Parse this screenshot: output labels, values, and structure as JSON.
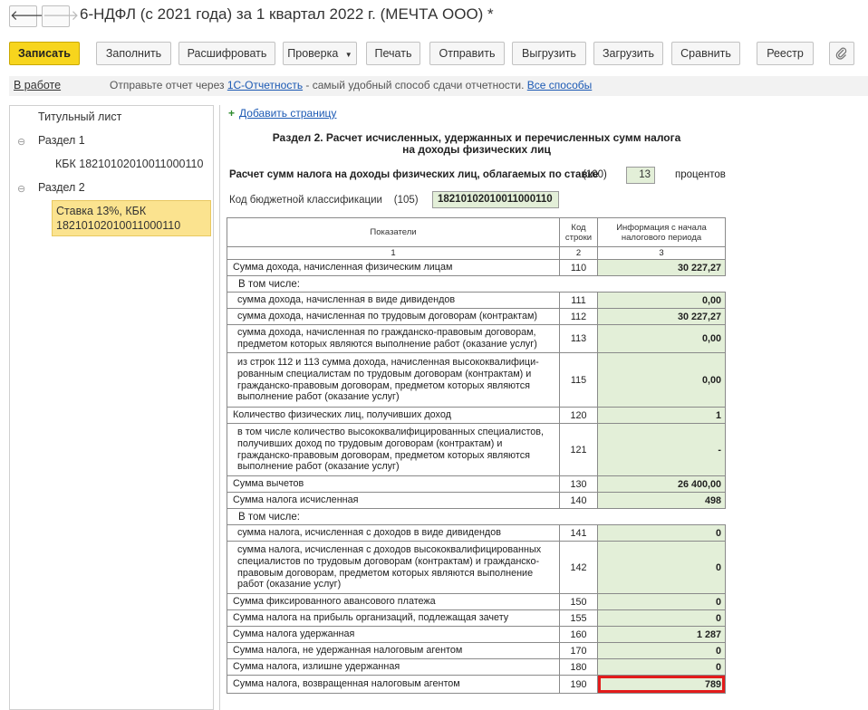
{
  "window": {
    "title": "6-НДФЛ (с 2021 года) за 1 квартал 2022 г. (МЕЧТА ООО) *",
    "back_glyph": "🡐",
    "forward_glyph": "🡒"
  },
  "toolbar": {
    "save": "Записать",
    "fill": "Заполнить",
    "decode": "Расшифровать",
    "check": "Проверка",
    "print": "Печать",
    "send": "Отправить",
    "export": "Выгрузить",
    "import": "Загрузить",
    "compare": "Сравнить",
    "registry": "Реестр",
    "attach_icon": "paperclip-icon"
  },
  "infobar": {
    "status": "В работе",
    "text_before": "Отправьте отчет через ",
    "link1": "1С-Отчетность",
    "text_after": " - самый удобный способ сдачи отчетности. ",
    "link2": "Все способы"
  },
  "tree": {
    "title_page": "Титульный лист",
    "section1": "Раздел 1",
    "section1_child": "КБК 18210102010011000110",
    "section2": "Раздел 2",
    "section2_child_line1": "Ставка 13%, КБК",
    "section2_child_line2": "18210102010011000110"
  },
  "form": {
    "add_page": "Добавить страницу",
    "section_title_line1": "Раздел 2. Расчет исчисленных, удержанных и перечисленных сумм налога",
    "section_title_line2": "на доходы физических лиц",
    "rate_label": "Расчет сумм налога на доходы физических лиц, облагаемых по ставке",
    "rate_code": "(100)",
    "rate_value": "13",
    "rate_unit": "процентов",
    "kbk_label": "Код бюджетной классификации",
    "kbk_code": "(105)",
    "kbk_value": "18210102010011000110",
    "table_headers": {
      "indicators": "Показатели",
      "code_line1": "Код",
      "code_line2": "строки",
      "info_line1": "Информация с начала",
      "info_line2": "налогового периода"
    },
    "col_numbers": [
      "1",
      "2",
      "3"
    ],
    "in_total": "В том числе:",
    "rows": [
      {
        "label": "Сумма дохода, начисленная физическим лицам",
        "code": "110",
        "value": "30 227,27"
      },
      {
        "label": "сумма дохода, начисленная в виде дивидендов",
        "code": "111",
        "value": "0,00"
      },
      {
        "label": "сумма дохода, начисленная по трудовым договорам (контрактам)",
        "code": "112",
        "value": "30 227,27"
      },
      {
        "label": "сумма дохода, начисленная по гражданско-правовым договорам, предметом которых являются выполнение работ (оказание услуг)",
        "code": "113",
        "value": "0,00"
      },
      {
        "label": "из строк 112 и 113 сумма дохода, начисленная высококвалифици-рованным специалистам по трудовым договорам (контрактам) и гражданско-правовым договорам, предметом которых являются выполнение работ (оказание услуг)",
        "code": "115",
        "value": "0,00"
      },
      {
        "label": "Количество физических лиц, получивших доход",
        "code": "120",
        "value": "1"
      },
      {
        "label": "в том числе количество высококвалифицированных специалистов, получивших доход по трудовым договорам (контрактам) и гражданско-правовым договорам, предметом которых являются выполнение работ (оказание услуг)",
        "code": "121",
        "value": "-"
      },
      {
        "label": "Сумма вычетов",
        "code": "130",
        "value": "26 400,00"
      },
      {
        "label": "Сумма налога исчисленная",
        "code": "140",
        "value": "498"
      },
      {
        "label": "сумма налога, исчисленная с доходов в виде дивидендов",
        "code": "141",
        "value": "0"
      },
      {
        "label": "сумма налога, исчисленная с доходов высококвалифицированных специалистов по трудовым договорам (контрактам) и гражданско-правовым договорам, предметом которых являются выполнение работ (оказание услуг)",
        "code": "142",
        "value": "0"
      },
      {
        "label": "Сумма фиксированного авансового платежа",
        "code": "150",
        "value": "0"
      },
      {
        "label": "Сумма налога на прибыль организаций, подлежащая зачету",
        "code": "155",
        "value": "0"
      },
      {
        "label": "Сумма налога удержанная",
        "code": "160",
        "value": "1 287"
      },
      {
        "label": "Сумма налога, не удержанная налоговым агентом",
        "code": "170",
        "value": "0"
      },
      {
        "label": "Сумма налога, излишне удержанная",
        "code": "180",
        "value": "0"
      },
      {
        "label": "Сумма налога, возвращенная налоговым агентом",
        "code": "190",
        "value": "789"
      }
    ]
  },
  "colors": {
    "primary_button": "#f7d51d",
    "input_fill": "#e3efd8",
    "tree_selected": "#fbe38f",
    "highlight_border": "#e31b1b",
    "link": "#1b59b4"
  }
}
